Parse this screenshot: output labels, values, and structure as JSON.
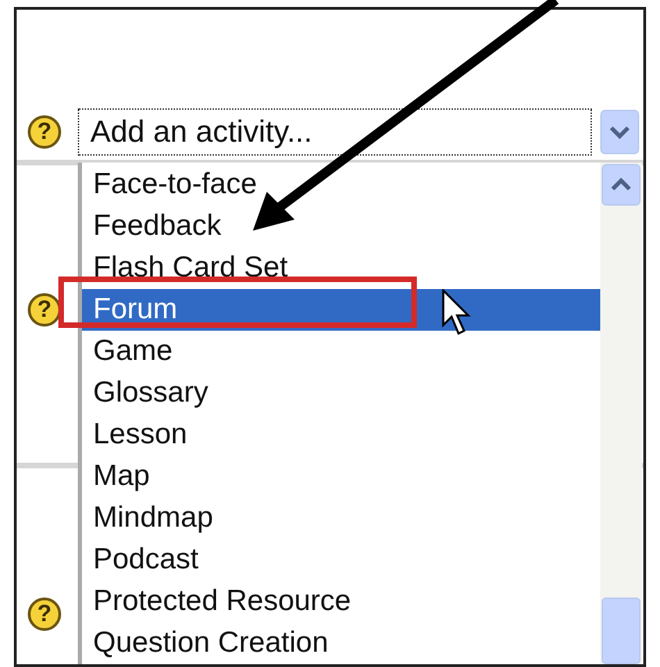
{
  "select": {
    "value": "Add an activity..."
  },
  "help_icons": [
    {
      "glyph": "?"
    },
    {
      "glyph": "?"
    },
    {
      "glyph": "?"
    }
  ],
  "options": [
    {
      "label": "Face-to-face",
      "selected": false
    },
    {
      "label": "Feedback",
      "selected": false
    },
    {
      "label": "Flash Card Set",
      "selected": false
    },
    {
      "label": "Forum",
      "selected": true
    },
    {
      "label": "Game",
      "selected": false
    },
    {
      "label": "Glossary",
      "selected": false
    },
    {
      "label": "Lesson",
      "selected": false
    },
    {
      "label": "Map",
      "selected": false
    },
    {
      "label": "Mindmap",
      "selected": false
    },
    {
      "label": "Podcast",
      "selected": false
    },
    {
      "label": "Protected Resource",
      "selected": false
    },
    {
      "label": "Question Creation",
      "selected": false
    }
  ]
}
